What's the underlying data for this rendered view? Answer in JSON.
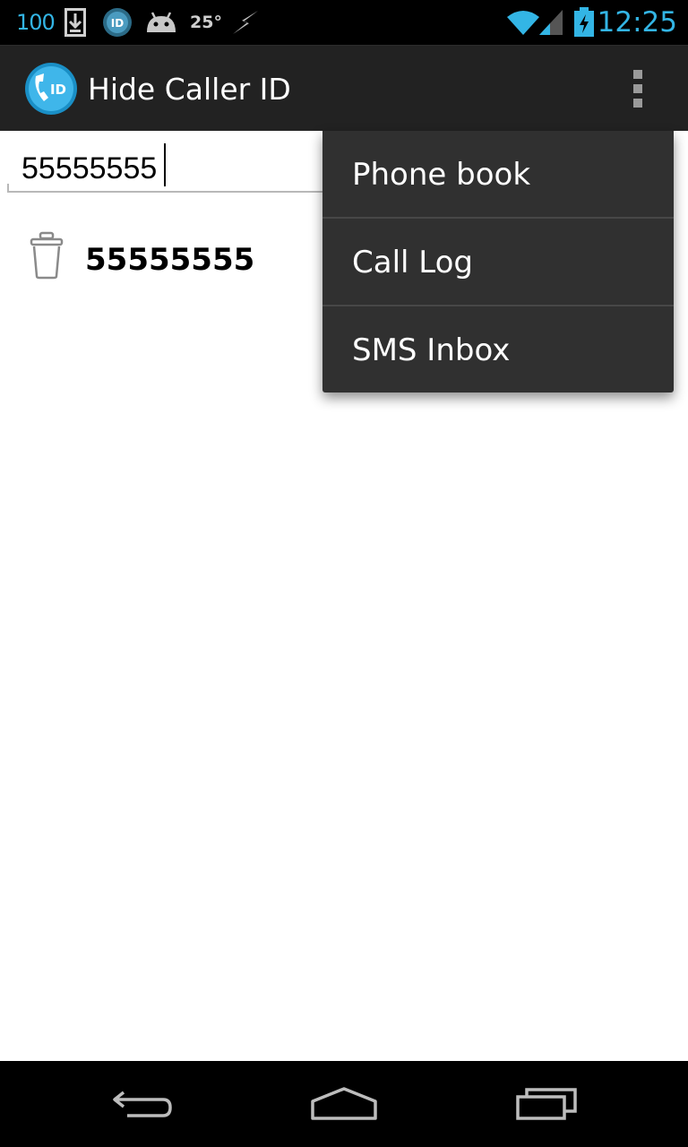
{
  "status_bar": {
    "battery_level_text": "100",
    "temperature": "25°",
    "time": "12:25",
    "icons": [
      "download-icon",
      "app-notification-icon",
      "android-icon",
      "flash-icon",
      "wifi-icon",
      "signal-icon",
      "battery-charging-icon"
    ],
    "accent_color": "#33b5e5"
  },
  "action_bar": {
    "title": "Hide Caller ID",
    "icon": "hide-caller-id-app-icon",
    "overflow_icon": "overflow-menu-icon"
  },
  "number_input": {
    "value": "55555555",
    "placeholder": ""
  },
  "blocked_numbers": [
    {
      "number": "55555555",
      "icon": "trash-icon"
    }
  ],
  "overflow_menu": {
    "items": [
      {
        "label": "Phone book"
      },
      {
        "label": "Call Log"
      },
      {
        "label": "SMS Inbox"
      }
    ]
  },
  "nav_bar": {
    "icons": [
      "back-icon",
      "home-icon",
      "recents-icon"
    ]
  }
}
